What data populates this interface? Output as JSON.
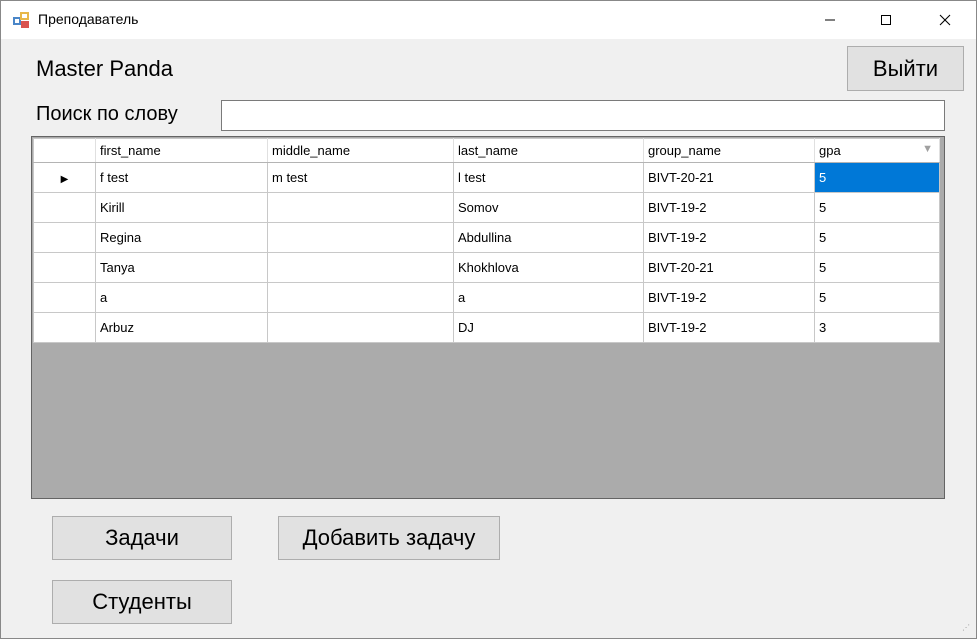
{
  "window": {
    "title": "Преподаватель",
    "minimize_icon": "minimize-icon",
    "maximize_icon": "maximize-icon",
    "close_icon": "close-icon"
  },
  "header": {
    "user_name": "Master Panda",
    "exit_label": "Выйти"
  },
  "search": {
    "label": "Поиск по слову",
    "value": "",
    "placeholder": ""
  },
  "table": {
    "columns": [
      "first_name",
      "middle_name",
      "last_name",
      "group_name",
      "gpa"
    ],
    "rows": [
      [
        "f test",
        "m test",
        "l test",
        "BIVT-20-21",
        "5"
      ],
      [
        "Kirill",
        "",
        "Somov",
        "BIVT-19-2",
        "5"
      ],
      [
        "Regina",
        "",
        "Abdullina",
        "BIVT-19-2",
        "5"
      ],
      [
        "Tanya",
        "",
        "Khokhlova",
        "BIVT-20-21",
        "5"
      ],
      [
        "a",
        "",
        "a",
        "BIVT-19-2",
        "5"
      ],
      [
        "Arbuz",
        "",
        "DJ",
        "BIVT-19-2",
        "3"
      ]
    ]
  },
  "buttons": {
    "tasks": "Задачи",
    "add_task": "Добавить задачу",
    "students": "Студенты"
  },
  "colors": {
    "selection": "#0078d7",
    "grid_background": "#ababab",
    "button_face": "#e1e1e1"
  }
}
